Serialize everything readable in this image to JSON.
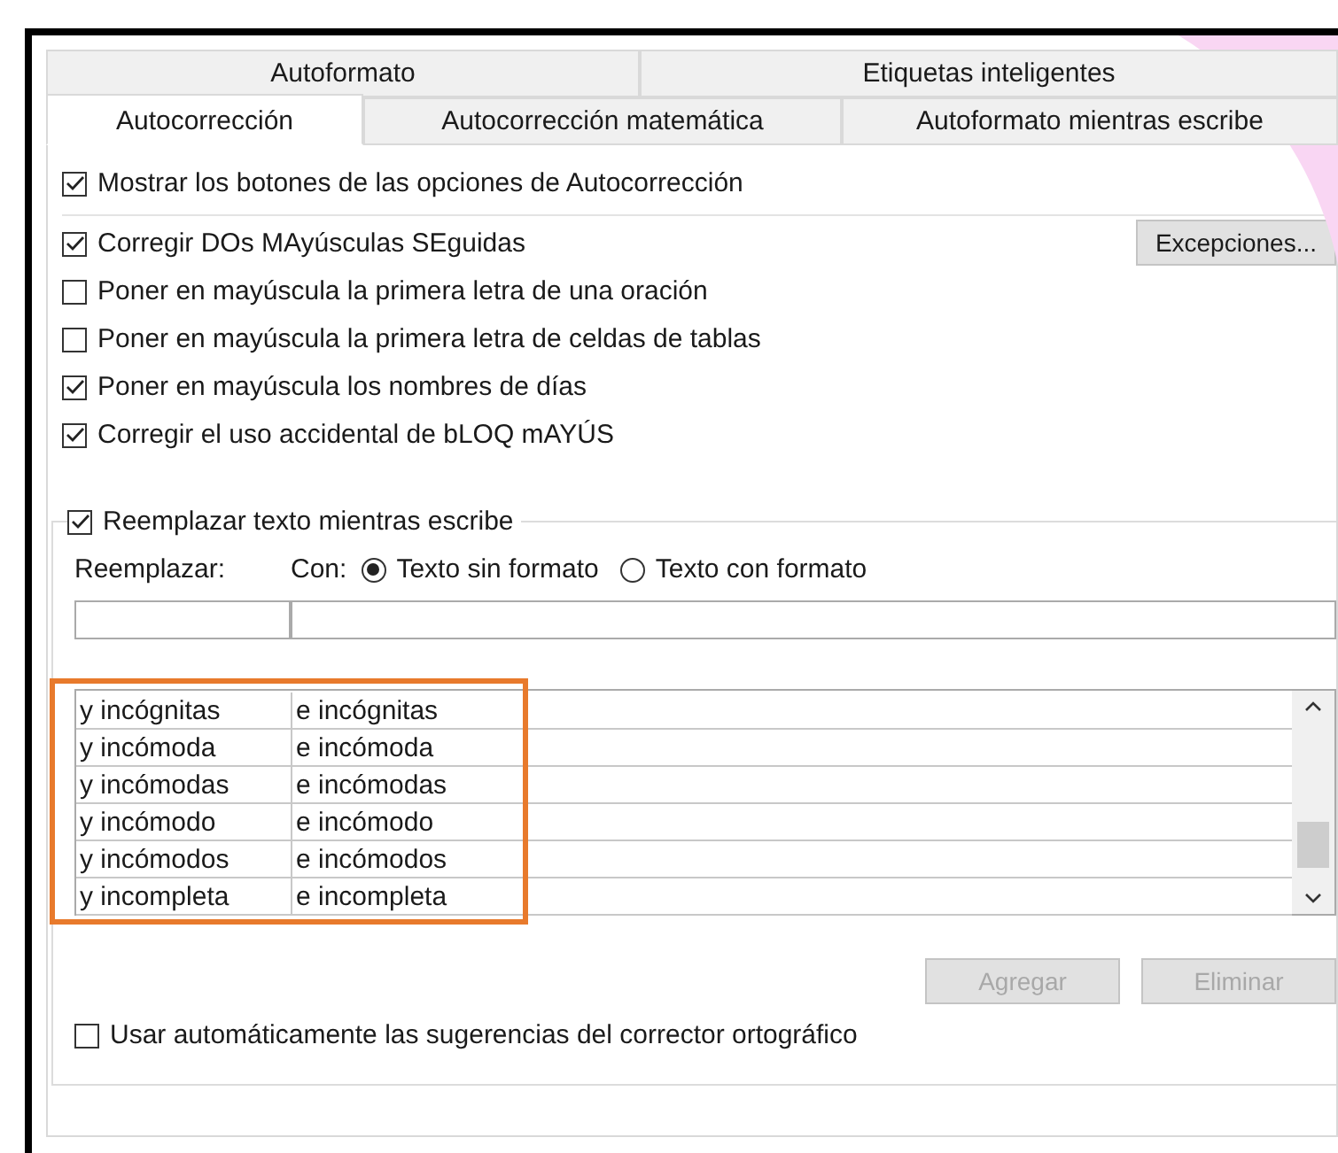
{
  "tabs_back": [
    {
      "label": "Autoformato",
      "selected": false
    },
    {
      "label": "Etiquetas inteligentes",
      "selected": false
    }
  ],
  "tabs_front": [
    {
      "label": "Autocorrección",
      "selected": true
    },
    {
      "label": "Autocorrección matemática",
      "selected": false
    },
    {
      "label": "Autoformato mientras escribe",
      "selected": false
    }
  ],
  "show_buttons_option": {
    "label": "Mostrar los botones de las opciones de Autocorrección",
    "checked": true
  },
  "options": [
    {
      "label": "Corregir DOs MAyúsculas SEguidas",
      "checked": true
    },
    {
      "label": "Poner en mayúscula la primera letra de una oración",
      "checked": false
    },
    {
      "label": "Poner en mayúscula la primera letra de celdas de tablas",
      "checked": false
    },
    {
      "label": "Poner en mayúscula los nombres de días",
      "checked": true
    },
    {
      "label": "Corregir el uso accidental de bLOQ mAYÚS",
      "checked": true
    }
  ],
  "exceptions_button": "Excepciones...",
  "replace_group": {
    "label": "Reemplazar texto mientras escribe",
    "checked": true
  },
  "replace_label": "Reemplazar:",
  "with_label": "Con:",
  "format_options": [
    {
      "label": "Texto sin formato",
      "selected": true
    },
    {
      "label": "Texto con formato",
      "selected": false
    }
  ],
  "entries": [
    {
      "replace": "y incógnitas",
      "with": "e incógnitas"
    },
    {
      "replace": "y incómoda",
      "with": "e incómoda"
    },
    {
      "replace": "y incómodas",
      "with": "e incómodas"
    },
    {
      "replace": "y incómodo",
      "with": "e incómodo"
    },
    {
      "replace": "y incómodos",
      "with": "e incómodos"
    },
    {
      "replace": "y incompleta",
      "with": "e incompleta"
    }
  ],
  "action_buttons": [
    {
      "label": "Agregar",
      "disabled": true
    },
    {
      "label": "Eliminar",
      "disabled": true
    }
  ],
  "spelling_option": {
    "label": "Usar automáticamente las sugerencias del corrector ortográfico",
    "checked": false
  }
}
